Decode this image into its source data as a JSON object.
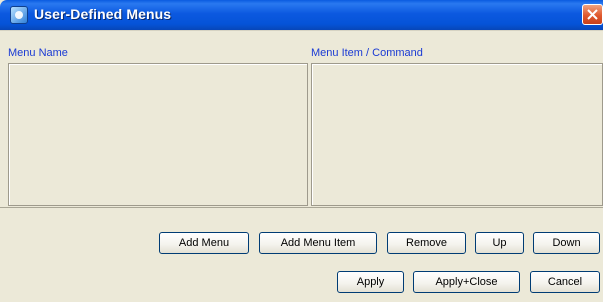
{
  "window": {
    "title": "User-Defined Menus",
    "icon": "app-icon",
    "close_icon": "close-icon"
  },
  "columns": {
    "menu_name": "Menu Name",
    "menu_item": "Menu Item / Command"
  },
  "buttons": {
    "add_menu": "Add Menu",
    "add_menu_item": "Add Menu Item",
    "remove": "Remove",
    "up": "Up",
    "down": "Down",
    "apply": "Apply",
    "apply_close": "Apply+Close",
    "cancel": "Cancel"
  },
  "colors": {
    "title_bar": "#0553d8",
    "label": "#1a3ad4",
    "close": "#e0592e",
    "background": "#ece9d8"
  }
}
